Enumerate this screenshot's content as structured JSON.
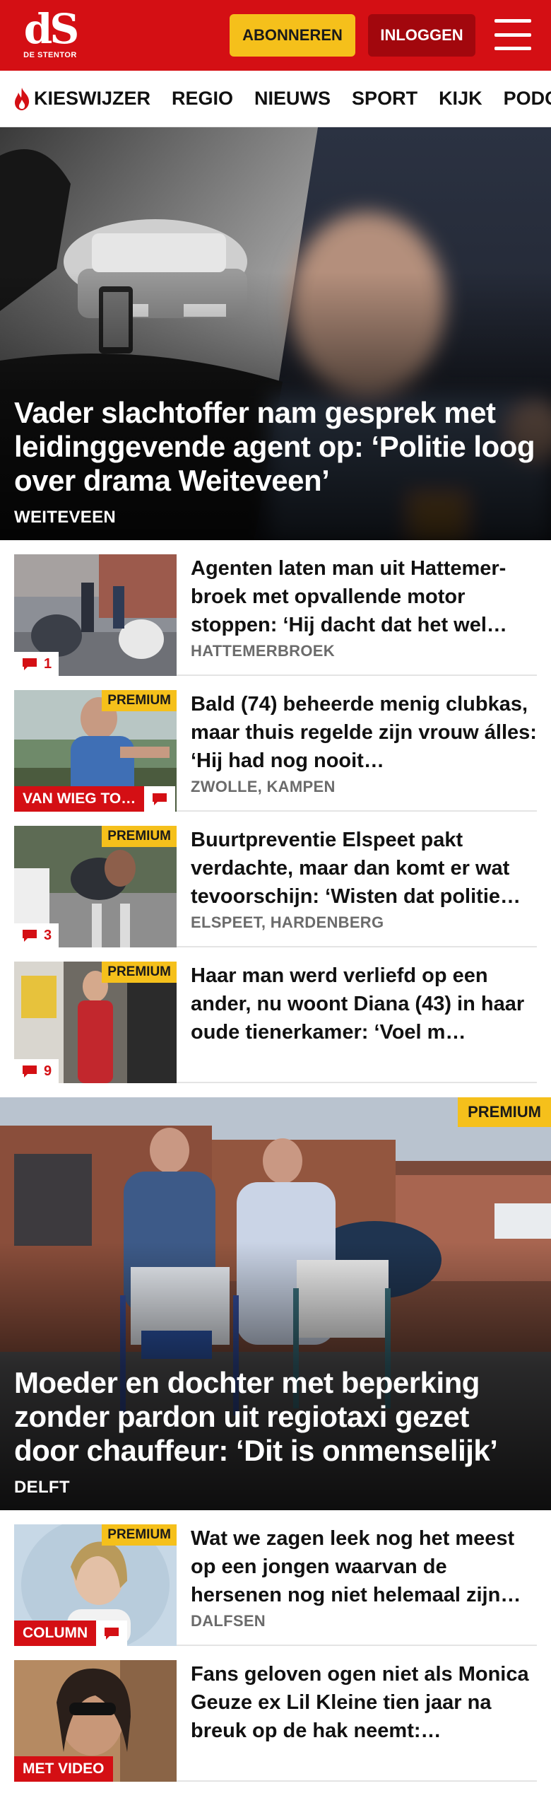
{
  "header": {
    "logo_mark": "dS",
    "logo_name": "DE STENTOR",
    "subscribe_label": "ABONNEREN",
    "login_label": "INLOGGEN"
  },
  "nav": [
    {
      "label": "KIESWIJZER",
      "icon": "flame-icon"
    },
    {
      "label": "REGIO"
    },
    {
      "label": "NIEUWS"
    },
    {
      "label": "SPORT"
    },
    {
      "label": "KIJK"
    },
    {
      "label": "PODCAS"
    }
  ],
  "hero1": {
    "title": "Vader slachtoffer nam gesprek met leidinggevende agent op: ‘Politie loog over drama Weiteveen’",
    "location": "WEITEVEEN"
  },
  "list1": [
    {
      "title": "Agenten laten man uit Hattemer-broek met opvallende motor stoppen: ‘Hij dacht dat het wel…",
      "location": "HATTEMERBROEK",
      "premium": false,
      "comments": "1"
    },
    {
      "title": "Bald (74) beheerde menig clubkas, maar thuis regelde zijn vrouw álles: ‘Hij had nog nooit…",
      "location": "ZWOLLE, KAMPEN",
      "premium": true,
      "badge": "VAN WIEG TO…"
    },
    {
      "title": "Buurtpreventie Elspeet pakt verdachte, maar dan komt er wat tevoorschijn: ‘Wisten dat politie…",
      "location": "ELSPEET, HARDENBERG",
      "premium": true,
      "comments": "3"
    },
    {
      "title": "Haar man werd verliefd op een ander, nu woont Diana (43) in haar oude tienerkamer: ‘Voel m…",
      "location": "",
      "premium": true,
      "comments": "9"
    }
  ],
  "hero2": {
    "title": "Moeder en dochter met beperking zonder pardon uit regiotaxi gezet door chauffeur: ‘Dit is onmenselijk’",
    "location": "DELFT",
    "premium": "PREMIUM"
  },
  "list2": [
    {
      "title": "Wat we zagen leek nog het meest op een jongen waarvan de hersenen nog niet helemaal zijn…",
      "location": "DALFSEN",
      "premium": true,
      "badge": "COLUMN"
    },
    {
      "title": "Fans geloven ogen niet als Monica Geuze ex Lil Kleine tien jaar na breuk op de hak neemt:…",
      "location": "",
      "premium": false,
      "badge": "MET VIDEO"
    }
  ],
  "labels": {
    "premium": "PREMIUM"
  },
  "colors": {
    "brand_red": "#d40f14",
    "premium_yellow": "#f5c01b",
    "login_dark_red": "#a2070d"
  }
}
